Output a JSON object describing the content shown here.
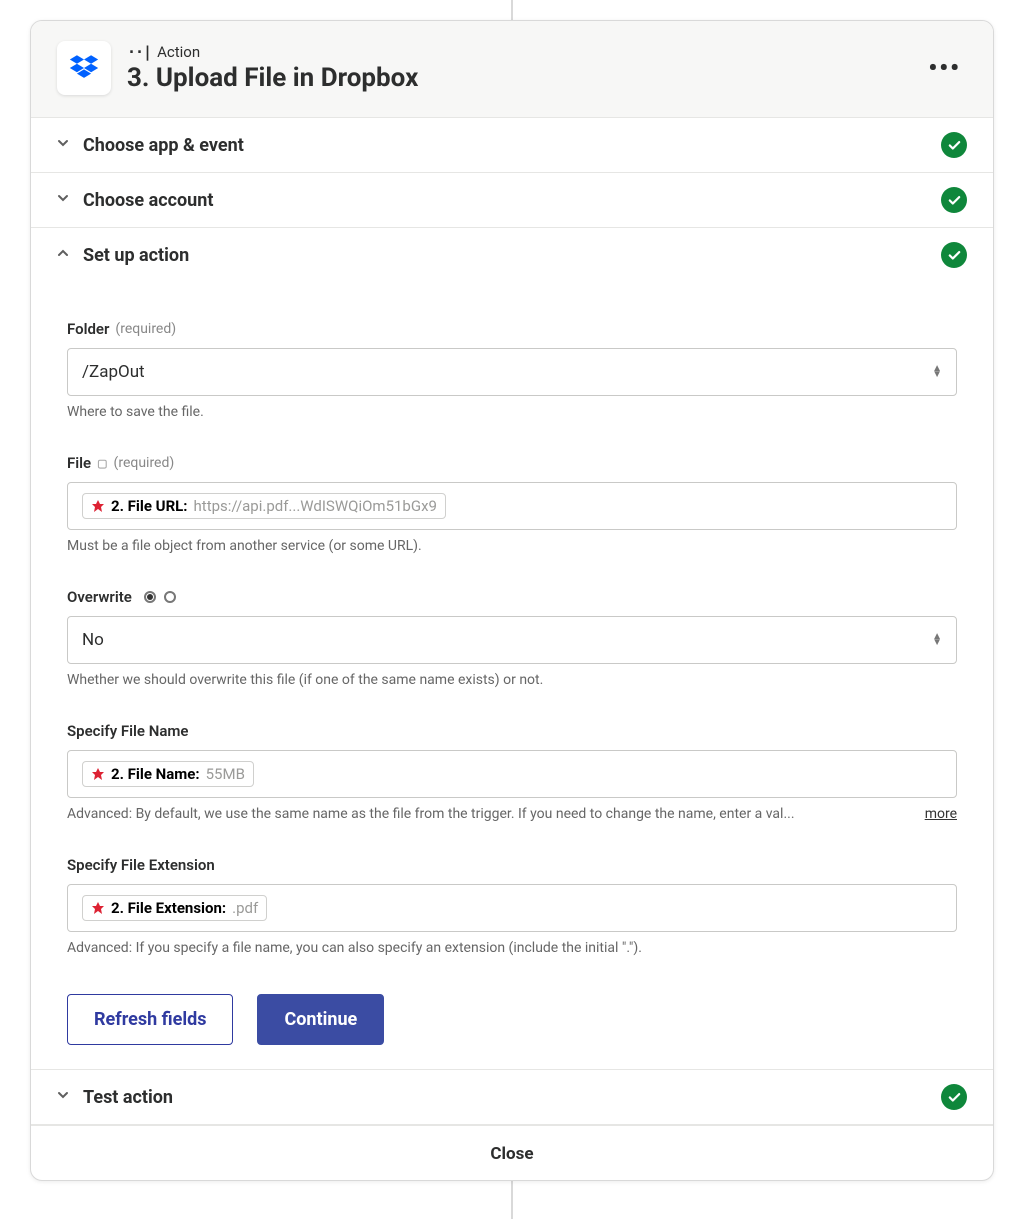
{
  "header": {
    "eyebrow": "Action",
    "title": "3. Upload File in Dropbox",
    "app_icon": "dropbox-icon"
  },
  "sections": {
    "choose_app": {
      "label": "Choose app & event",
      "complete": true,
      "expanded": false
    },
    "choose_account": {
      "label": "Choose account",
      "complete": true,
      "expanded": false
    },
    "setup_action": {
      "label": "Set up action",
      "complete": true,
      "expanded": true
    },
    "test_action": {
      "label": "Test action",
      "complete": true,
      "expanded": false
    }
  },
  "form": {
    "folder": {
      "label": "Folder",
      "required_text": "(required)",
      "value": "/ZapOut",
      "help": "Where to save the file."
    },
    "file": {
      "label": "File",
      "required_text": "(required)",
      "token_label": "2. File URL:",
      "token_value": "https://api.pdf...WdISWQiOm51bGx9",
      "help": "Must be a file object from another service (or some URL)."
    },
    "overwrite": {
      "label": "Overwrite",
      "value": "No",
      "help": "Whether we should overwrite this file (if one of the same name exists) or not."
    },
    "file_name": {
      "label": "Specify File Name",
      "token_label": "2. File Name:",
      "token_value": "55MB",
      "help": "Advanced: By default, we use the same name as the file from the trigger. If you need to change the name, enter a val...",
      "more": "more"
    },
    "file_ext": {
      "label": "Specify File Extension",
      "token_label": "2. File Extension:",
      "token_value": ".pdf",
      "help": "Advanced: If you specify a file name, you can also specify an extension (include the initial \".\")."
    }
  },
  "buttons": {
    "refresh": "Refresh fields",
    "continue": "Continue"
  },
  "footer": {
    "close": "Close"
  }
}
